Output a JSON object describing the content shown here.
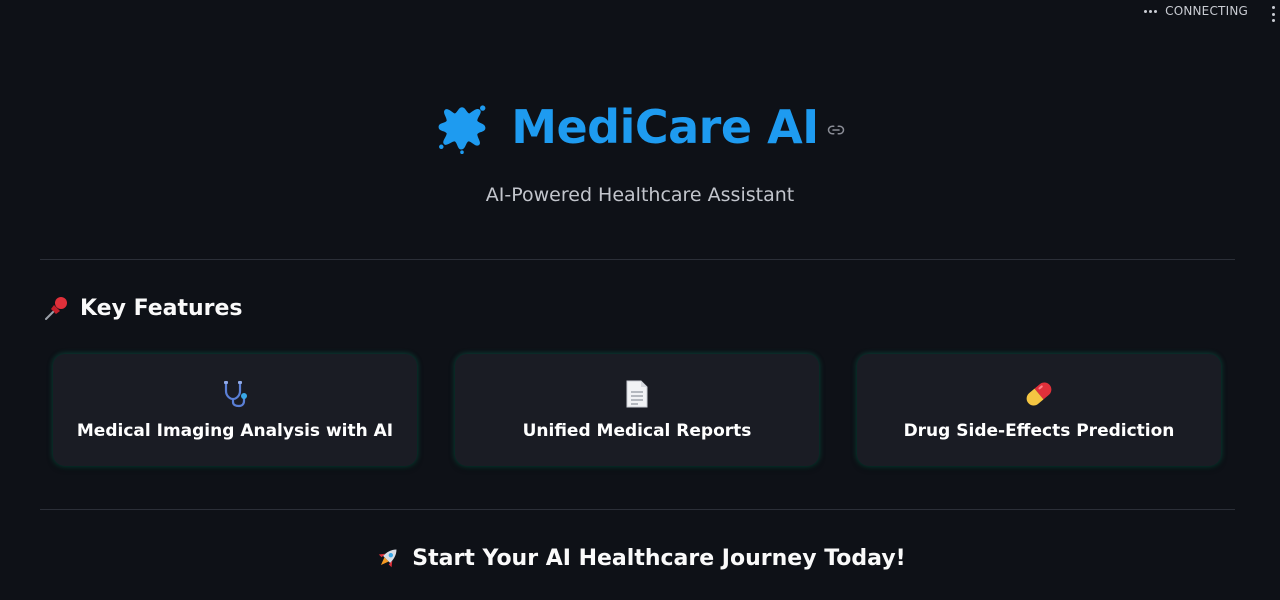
{
  "status": {
    "text": "CONNECTING"
  },
  "hero": {
    "title": "MediCare AI",
    "subtitle": "AI-Powered Healthcare Assistant",
    "title_color": "#1e9bf0",
    "icon": "blue-splat-icon"
  },
  "features": {
    "heading": "Key Features",
    "heading_icon": "pushpin-icon",
    "items": [
      {
        "label": "Medical Imaging Analysis with AI",
        "icon": "stethoscope-icon"
      },
      {
        "label": "Unified Medical Reports",
        "icon": "document-icon"
      },
      {
        "label": "Drug Side-Effects Prediction",
        "icon": "pill-icon"
      }
    ]
  },
  "cta": {
    "text": "Start Your AI Healthcare Journey Today!",
    "icon": "rocket-icon"
  },
  "colors": {
    "background": "#0e1117",
    "card_background": "#1a1c24",
    "card_glow": "#00c896",
    "accent": "#1e9bf0"
  }
}
